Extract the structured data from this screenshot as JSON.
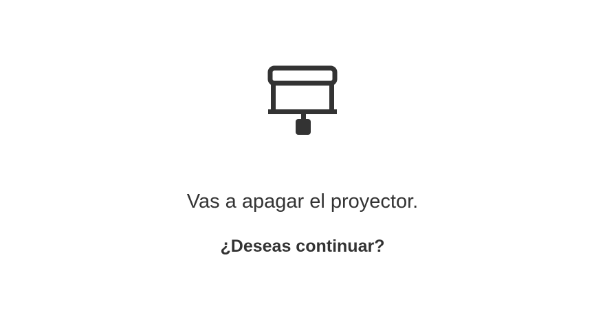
{
  "dialog": {
    "icon": "projector-screen-icon",
    "message": "Vas a apagar el proyector.",
    "question": "¿Deseas continuar?",
    "text_color": "#333333",
    "background_color": "#ffffff"
  }
}
